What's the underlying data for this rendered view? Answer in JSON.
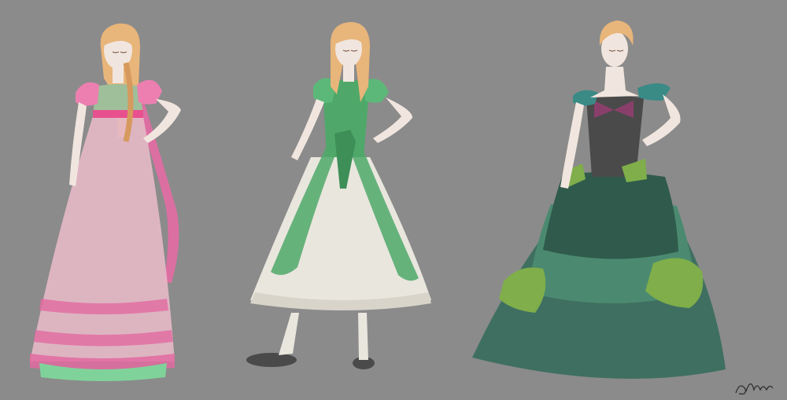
{
  "scene": {
    "background_color": "#8b8b8b",
    "figures": [
      {
        "name": "figure-pink-gown",
        "dress_color": "#e6a3b8",
        "trim_color": "#e05a9a",
        "hem_color": "#7fd39a"
      },
      {
        "name": "figure-green-overdress",
        "dress_color": "#4fa86a",
        "underskirt_color": "#e9e6de"
      },
      {
        "name": "figure-teal-ballgown",
        "dress_color": "#3f6f61",
        "accent_color": "#7fae4a",
        "bodice_color": "#4a4a4a"
      }
    ],
    "skin_color": "#f1e6df",
    "hair_color": "#e8b57a"
  }
}
